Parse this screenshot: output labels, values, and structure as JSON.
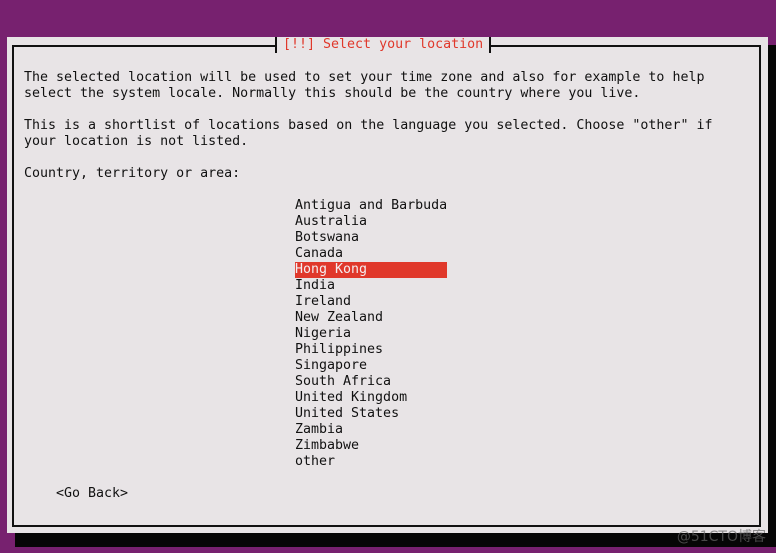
{
  "dialog": {
    "title": "[!!] Select your location",
    "paragraph1_line1": "The selected location will be used to set your time zone and also for example to help",
    "paragraph1_line2": "select the system locale. Normally this should be the country where you live.",
    "paragraph2_line1": "This is a shortlist of locations based on the language you selected. Choose \"other\" if",
    "paragraph2_line2": "your location is not listed.",
    "prompt": "Country, territory or area:",
    "options": [
      "Antigua and Barbuda",
      "Australia",
      "Botswana",
      "Canada",
      "Hong Kong",
      "India",
      "Ireland",
      "New Zealand",
      "Nigeria",
      "Philippines",
      "Singapore",
      "South Africa",
      "United Kingdom",
      "United States",
      "Zambia",
      "Zimbabwe",
      "other"
    ],
    "selected_index": 4,
    "go_back": "<Go Back>"
  },
  "watermark": "@51CTO博客",
  "colors": {
    "background": "#77216f",
    "dialog": "#e8e4e6",
    "accent": "#e0382b"
  }
}
